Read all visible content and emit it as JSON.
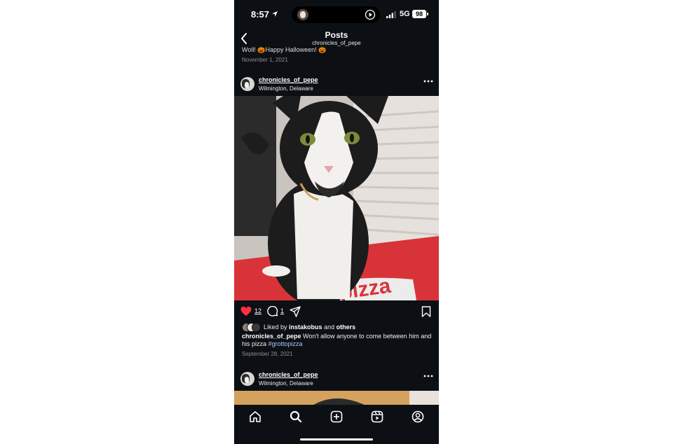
{
  "status_bar": {
    "time": "8:57",
    "network": "5G",
    "battery": "98"
  },
  "header": {
    "title": "Posts",
    "subtitle": "chronicles_of_pepe"
  },
  "previous_post": {
    "caption": "Woll! 🎃Happy Halloween! 🎃",
    "date": "November 1, 2021"
  },
  "post": {
    "username": "chronicles_of_pepe",
    "location": "Wilmington, Delaware",
    "likes": "12",
    "comments": "1",
    "liked_by_prefix": "Liked by",
    "liked_by_user": "instakobus",
    "liked_by_and": "and",
    "liked_by_others": "others",
    "caption_user": "chronicles_of_pepe",
    "caption_text": "Won't allow anyone to come between him and his pizza",
    "hashtag": "#grottopizza",
    "date": "September 28, 2021"
  },
  "next_post": {
    "username": "chronicles_of_pepe",
    "location": "Wilmington, Delaware"
  },
  "tab_bar": {
    "items": [
      "home",
      "search",
      "create",
      "reels",
      "profile"
    ]
  },
  "colors": {
    "background": "#0c1014",
    "like": "#ff3040",
    "link": "#a8c7ff"
  }
}
